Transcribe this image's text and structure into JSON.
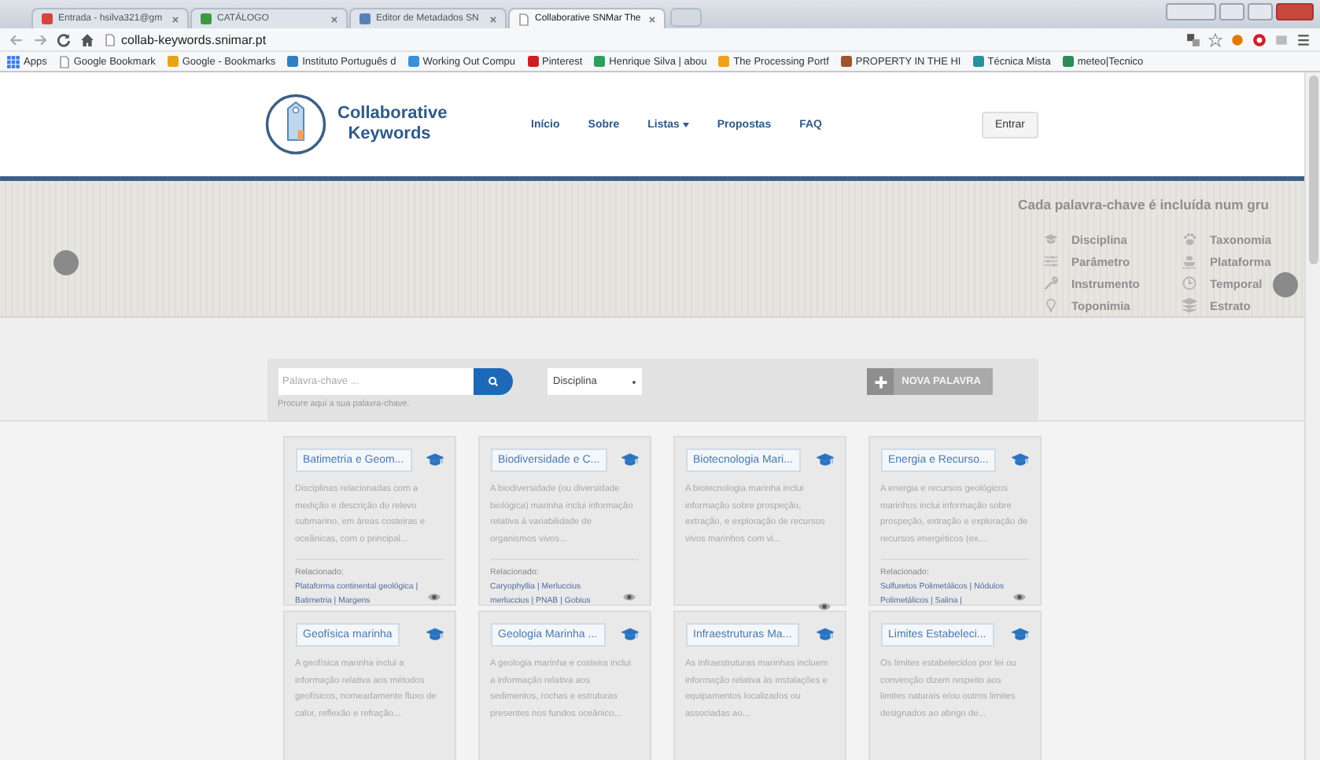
{
  "browser": {
    "tabs": [
      {
        "title": "Entrada - hsilva321@gm",
        "kind": "favicon",
        "color": "#d44638",
        "selected": false
      },
      {
        "title": "CATÁLOGO",
        "kind": "favicon",
        "color": "#3c9a3c",
        "selected": false
      },
      {
        "title": "Editor de Metadados SN",
        "kind": "favicon",
        "color": "#5a7fb5",
        "selected": false
      },
      {
        "title": "Collaborative SNMar The",
        "kind": "page",
        "selected": true
      }
    ],
    "address": "collab-keywords.snimar.pt",
    "bookmarks": [
      {
        "label": "Apps",
        "kind": "apps"
      },
      {
        "label": "Google Bookmark",
        "kind": "page"
      },
      {
        "label": "Google - Bookmarks",
        "kind": "favicon",
        "color": "#e8a317"
      },
      {
        "label": "Instituto Português d",
        "kind": "favicon",
        "color": "#2f7fc1"
      },
      {
        "label": "Working Out Compu",
        "kind": "favicon",
        "color": "#3a8fd6"
      },
      {
        "label": "Pinterest",
        "kind": "favicon",
        "color": "#cb2027"
      },
      {
        "label": "Henrique Silva | abou",
        "kind": "favicon",
        "color": "#2e9e5b"
      },
      {
        "label": "The Processing Portf",
        "kind": "favicon",
        "color": "#f0a020"
      },
      {
        "label": "PROPERTY IN THE HI",
        "kind": "favicon",
        "color": "#a0522d"
      },
      {
        "label": "Técnica Mista",
        "kind": "favicon",
        "color": "#2a8fa0"
      },
      {
        "label": "meteo|Tecnico",
        "kind": "favicon",
        "color": "#2e8b57"
      }
    ]
  },
  "header": {
    "logo_text": "Collaborative Keywords",
    "nav": [
      {
        "label": "Início",
        "has_menu": false
      },
      {
        "label": "Sobre",
        "has_menu": false
      },
      {
        "label": "Listas",
        "has_menu": true
      },
      {
        "label": "Propostas",
        "has_menu": false
      },
      {
        "label": "FAQ",
        "has_menu": false
      }
    ],
    "login_button": "Entrar"
  },
  "banner": {
    "heading": "Cada palavra-chave é incluída num gru",
    "categories": [
      {
        "label": "Disciplina",
        "kind": "cap"
      },
      {
        "label": "Parâmetro",
        "kind": "sliders"
      },
      {
        "label": "Instrumento",
        "kind": "wrench"
      },
      {
        "label": "Toponímia",
        "kind": "pin"
      },
      {
        "label": "Taxonomia",
        "kind": "paw"
      },
      {
        "label": "Plataforma",
        "kind": "ship"
      },
      {
        "label": "Temporal",
        "kind": "clock"
      },
      {
        "label": "Estrato",
        "kind": "layers"
      }
    ]
  },
  "search": {
    "placeholder": "Palavra-chave ...",
    "help": "Procure aqui a sua palavra-chave.",
    "filter": "Disciplina",
    "new_button": "NOVA PALAVRA"
  },
  "cards": [
    {
      "title": "Batimetria e Geom...",
      "description": "Disciplinas relacionadas com a medição e descrição do relevo submarino, em áreas costeiras e oceânicas, com o principal...",
      "related_label": "Relacionado:",
      "related": "Plataforma continental geológica | Batimetria | Margens"
    },
    {
      "title": "Biodiversidade e C...",
      "description": "A biodiversidade (ou diversidade biológica) marinha inclui informação relativa à variabilidade de organismos vivos...",
      "related_label": "Relacionado:",
      "related": "Caryophyllia | Merluccius merluccius | PNAB | Gobius"
    },
    {
      "title": "Biotecnologia Mari...",
      "description": "A biotecnologia marinha inclui informação sobre prospeção, extração, e exploração de recursos vivos marinhos com vi..."
    },
    {
      "title": "Energia e Recurso...",
      "description": "A energia e recursos geológicos marinhos inclui informação sobre prospeção, extração e exploração de recursos energéticos (ex....",
      "related_label": "Relacionado:",
      "related": "Sulfuretos Polimetálicos | Nódulos Polimetálicos | Salina |"
    },
    {
      "title": "Geofísica marinha",
      "description": "A geofísica marinha inclui a informação relativa aos métodos geofísicos, nomeadamente fluxo de calor, reflexão e refração..."
    },
    {
      "title": "Geologia Marinha ...",
      "description": "A geologia marinha e costeira inclui a informação relativa aos sedimentos, rochas e estruturas presentes nos fundos oceânico..."
    },
    {
      "title": "Infraestruturas Ma...",
      "description": "As infraestruturas marinhas incluem informação relativa às instalações e equipamentos localizados ou associadas ao..."
    },
    {
      "title": "Limites Estabeleci...",
      "description": "Os limites estabelecidos por lei ou convenção dizem respeito aos limites naturais e/ou outros limites designados ao abrigo de..."
    }
  ]
}
